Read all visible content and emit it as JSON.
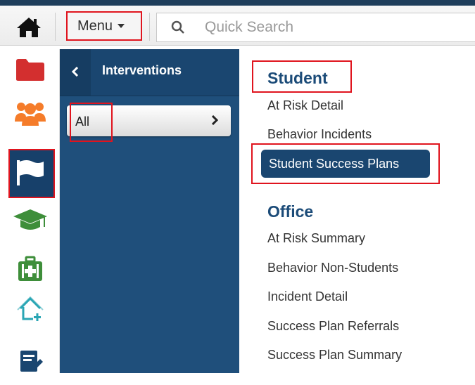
{
  "header": {
    "menu_label": "Menu",
    "search_placeholder": "Quick Search"
  },
  "rail": {
    "items": [
      {
        "icon": "folder-icon",
        "color": "#d32f2f"
      },
      {
        "icon": "users-icon",
        "color": "#f57c2a"
      },
      {
        "icon": "flag-icon",
        "color": "#ffffff"
      },
      {
        "icon": "graduation-cap-icon",
        "color": "#3e8e3a"
      },
      {
        "icon": "medical-kit-icon",
        "color": "#3e8e3a"
      },
      {
        "icon": "home-plus-icon",
        "color": "#2aa6b4"
      },
      {
        "icon": "report-icon",
        "color": "#1a4670"
      }
    ]
  },
  "panel": {
    "title": "Interventions",
    "items": [
      {
        "label": "All"
      }
    ]
  },
  "content": {
    "sections": [
      {
        "heading": "Student",
        "links": [
          "At Risk Detail",
          "Behavior Incidents",
          "Student Success Plans"
        ]
      },
      {
        "heading": "Office",
        "links": [
          "At Risk Summary",
          "Behavior Non-Students",
          "Incident Detail",
          "Success Plan Referrals",
          "Success Plan Summary"
        ]
      }
    ]
  },
  "colors": {
    "navy": "#1a4670",
    "highlight_red": "#e0141e"
  }
}
